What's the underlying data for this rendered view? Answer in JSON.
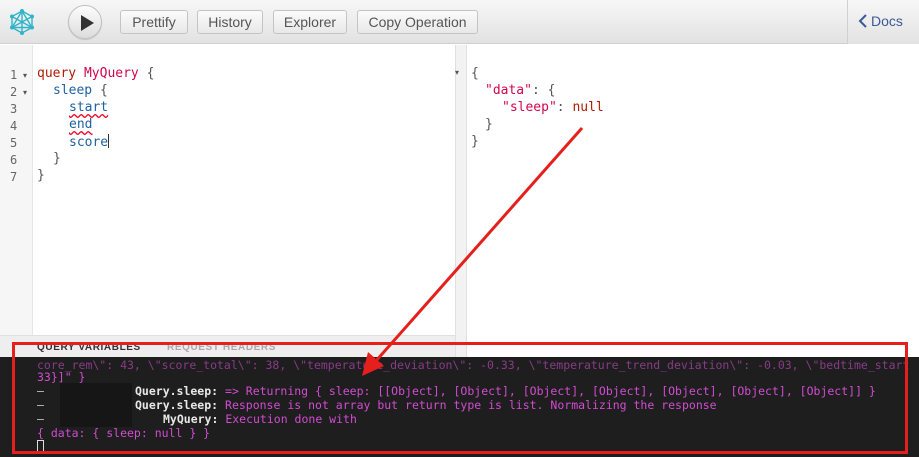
{
  "toolbar": {
    "prettify_label": "Prettify",
    "history_label": "History",
    "explorer_label": "Explorer",
    "copy_operation_label": "Copy Operation",
    "docs_label": "Docs"
  },
  "editor": {
    "line_numbers": [
      "1",
      "2",
      "3",
      "4",
      "5",
      "6",
      "7"
    ],
    "query_keyword": "query",
    "operation_name": "MyQuery",
    "open_brace": "{",
    "sleep_field": "sleep",
    "start_field": "start",
    "end_field": "end",
    "score_field": "score",
    "close_brace": "}"
  },
  "result": {
    "data_key": "\"data\"",
    "sleep_key": "\"sleep\"",
    "sleep_value": "null"
  },
  "bottom_tabs": {
    "query_variables": "QUERY VARIABLES",
    "request_headers": "REQUEST HEADERS"
  },
  "terminal": {
    "line1": "core_rem\\\": 43, \\\"score_total\\\": 38, \\\"temperature_deviation\\\": -0.33, \\\"temperature_trend_deviation\\\": -0.03, \\\"bedtime_start",
    "line2": "33}]\" }",
    "line3_prefix": "Query.sleep:",
    "line3_text": " => Returning { sleep: [[Object], [Object], [Object], [Object], [Object], [Object], [Object]] }",
    "line4_prefix": "Query.sleep:",
    "line4_text": " Response is not array but return type is list. Normalizing the response",
    "line5_prefix": "MyQuery:",
    "line5_text": " Execution done with",
    "line6_text": "{ data: { sleep: null } }",
    "dash": "—"
  },
  "colors": {
    "annotation": "#e5201c",
    "terminal_bg": "#1e1e1e",
    "terminal_text": "#d24cd2"
  }
}
